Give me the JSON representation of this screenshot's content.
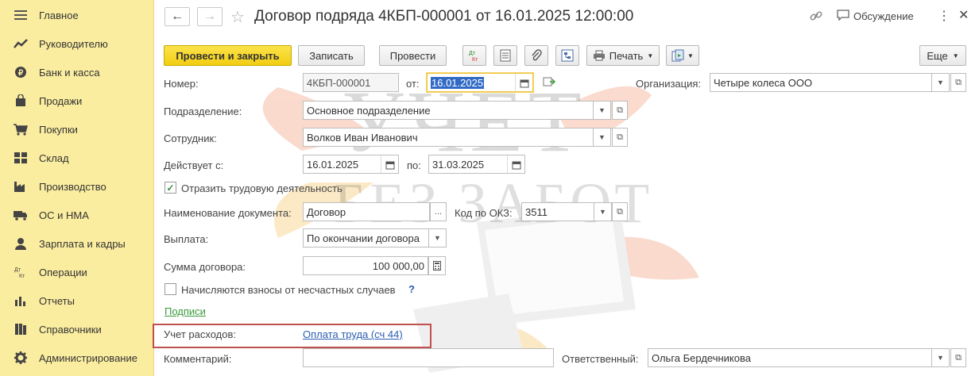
{
  "sidebar": {
    "items": [
      {
        "label": "Главное",
        "icon": "menu-icon"
      },
      {
        "label": "Руководителю",
        "icon": "trend-icon"
      },
      {
        "label": "Банк и касса",
        "icon": "coins-icon"
      },
      {
        "label": "Продажи",
        "icon": "bag-icon"
      },
      {
        "label": "Покупки",
        "icon": "cart-icon"
      },
      {
        "label": "Склад",
        "icon": "warehouse-icon"
      },
      {
        "label": "Производство",
        "icon": "factory-icon"
      },
      {
        "label": "ОС и НМА",
        "icon": "truck-icon"
      },
      {
        "label": "Зарплата и кадры",
        "icon": "person-icon"
      },
      {
        "label": "Операции",
        "icon": "dt-kt-icon"
      },
      {
        "label": "Отчеты",
        "icon": "bar-chart-icon"
      },
      {
        "label": "Справочники",
        "icon": "books-icon"
      },
      {
        "label": "Администрирование",
        "icon": "gear-icon"
      }
    ]
  },
  "header": {
    "title": "Договор подряда 4КБП-000001 от 16.01.2025 12:00:00",
    "discussion_label": "Обсуждение"
  },
  "toolbar": {
    "post_close_label": "Провести и закрыть",
    "save_label": "Записать",
    "post_label": "Провести",
    "dtkt_label": "Дт Кт",
    "print_label": "Печать",
    "more_label": "Еще"
  },
  "form": {
    "number_label": "Номер:",
    "number_value": "4КБП-000001",
    "date_from_label": "от:",
    "date_value": "16.01.2025",
    "org_label": "Организация:",
    "org_value": "Четыре колеса ООО",
    "department_label": "Подразделение:",
    "department_value": "Основное подразделение",
    "employee_label": "Сотрудник:",
    "employee_value": "Волков Иван Иванович",
    "valid_from_label": "Действует с:",
    "valid_from_value": "16.01.2025",
    "valid_to_label": "по:",
    "valid_to_value": "31.03.2025",
    "labor_activity_label": "Отразить трудовую деятельность",
    "labor_activity_checked": true,
    "doc_name_label": "Наименование документа:",
    "doc_name_value": "Договор",
    "okz_label": "Код по ОКЗ:",
    "okz_value": "3511",
    "payment_label": "Выплата:",
    "payment_value": "По окончании договора",
    "amount_label": "Сумма договора:",
    "amount_value": "100 000,00",
    "accident_label": "Начисляются взносы от несчастных случаев",
    "accident_checked": false,
    "help_mark": "?",
    "signatures_link": "Подписи",
    "expense_label": "Учет расходов:",
    "expense_link": "Оплата труда (сч 44)",
    "comment_label": "Комментарий:",
    "comment_value": "",
    "responsible_label": "Ответственный:",
    "responsible_value": "Ольга Бердечникова"
  },
  "watermark": {
    "line1": "УЧЕТ",
    "line2": "БЕЗ ЗАБОТ"
  },
  "colors": {
    "sidebar_bg": "#fbeda0",
    "primary_button": "#f2cd12",
    "link_blue": "#2a5db0",
    "link_green": "#3a9a3a",
    "highlight_border": "#c0504d"
  }
}
